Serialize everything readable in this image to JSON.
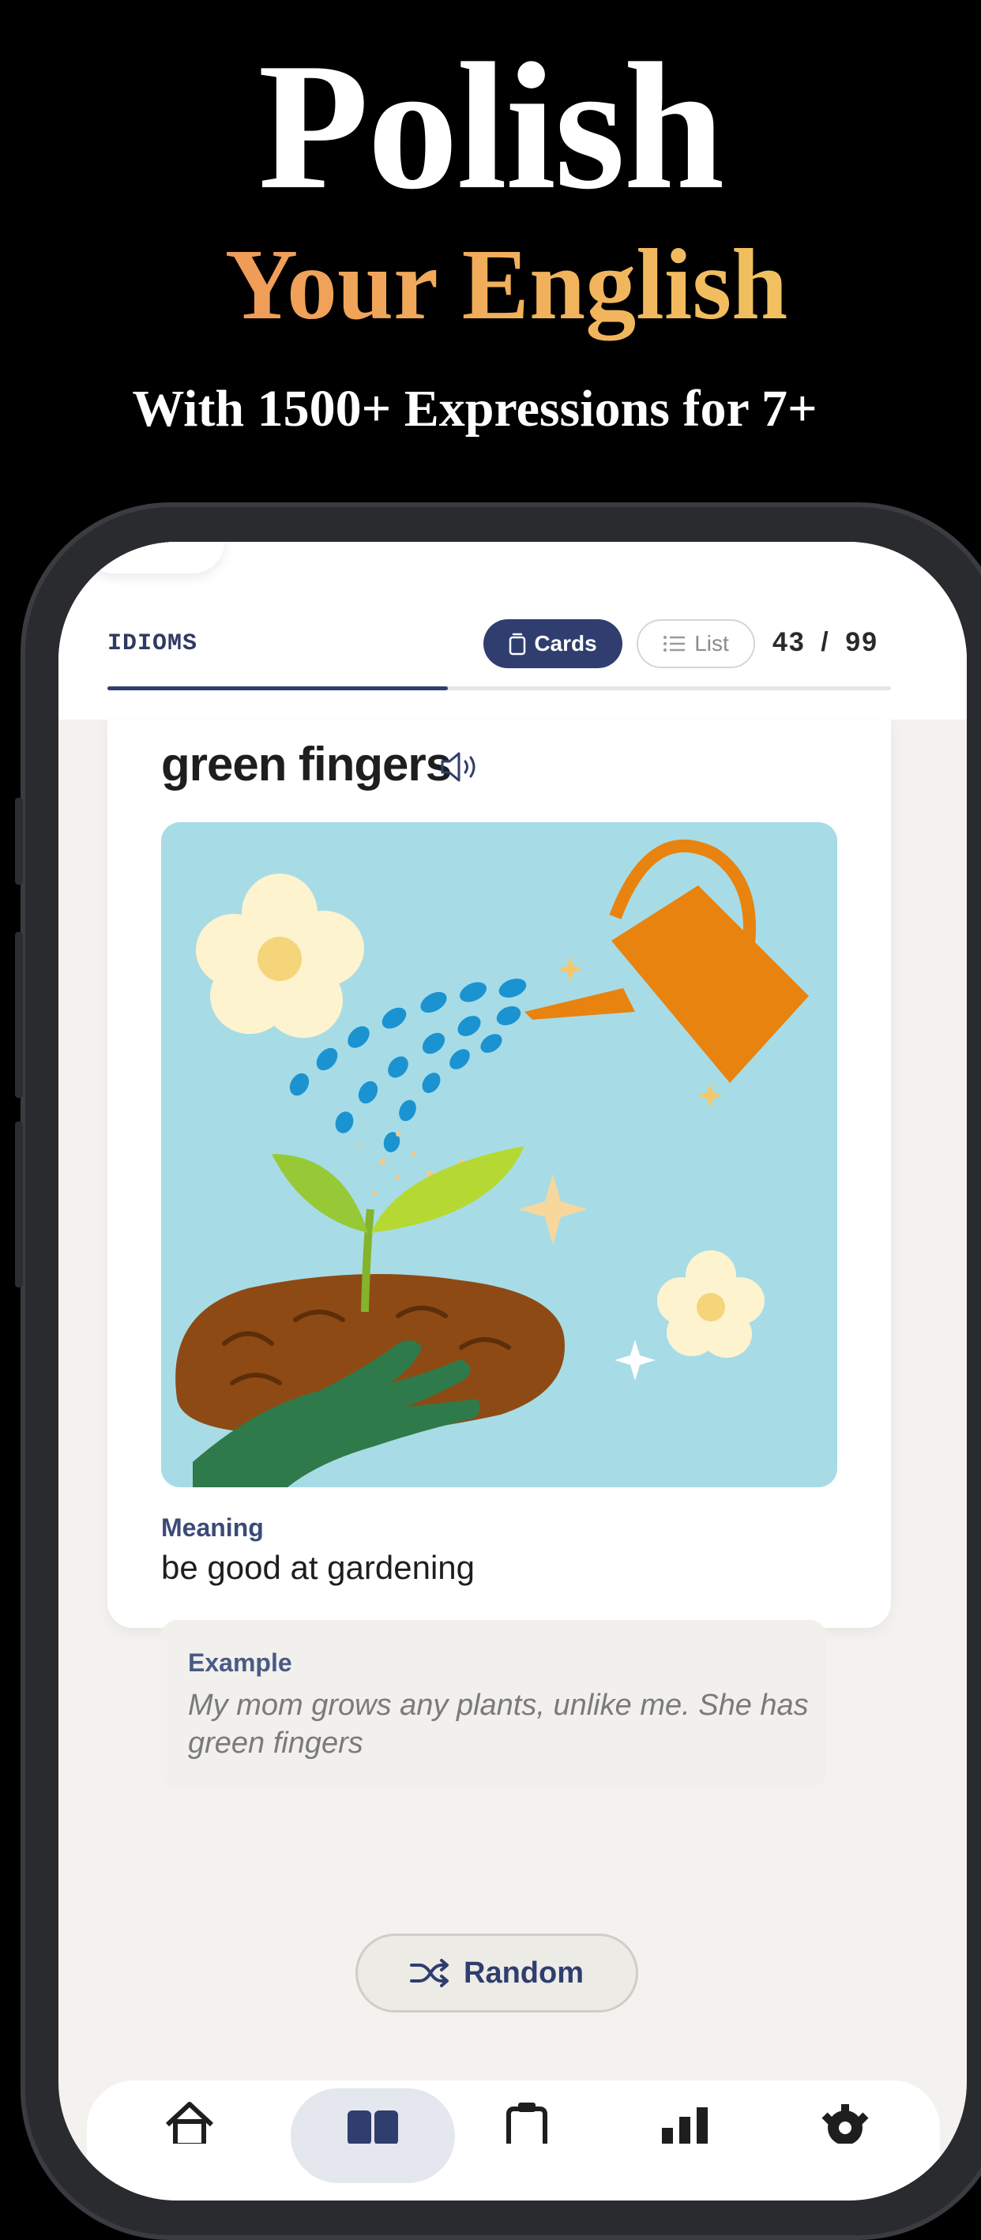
{
  "promo": {
    "title": "Polish",
    "subtitle": "Your English",
    "tagline": "With 1500+ Expressions for 7+"
  },
  "app": {
    "header": {
      "category": "IDIOMS",
      "view_cards_label": "Cards",
      "view_list_label": "List",
      "current": "43",
      "separator": "/",
      "total": "99",
      "progress": 0.4343
    },
    "card": {
      "expression": "green fingers",
      "meaning_label": "Meaning",
      "meaning": "be good at gardening",
      "example_label": "Example",
      "example": "My mom grows any plants, unlike me. She has green fingers"
    },
    "random_label": "Random",
    "tabs": [
      {
        "icon": "home-icon"
      },
      {
        "icon": "cards-icon",
        "active": true
      },
      {
        "icon": "clipboard-icon"
      },
      {
        "icon": "stats-icon"
      },
      {
        "icon": "gear-icon"
      }
    ]
  },
  "colors": {
    "accent": "#2f3e6e",
    "background": "#f4f2ee",
    "illustration_bg": "#a7dce6",
    "gradient_start": "#ee8c55",
    "gradient_end": "#f1cf63"
  }
}
